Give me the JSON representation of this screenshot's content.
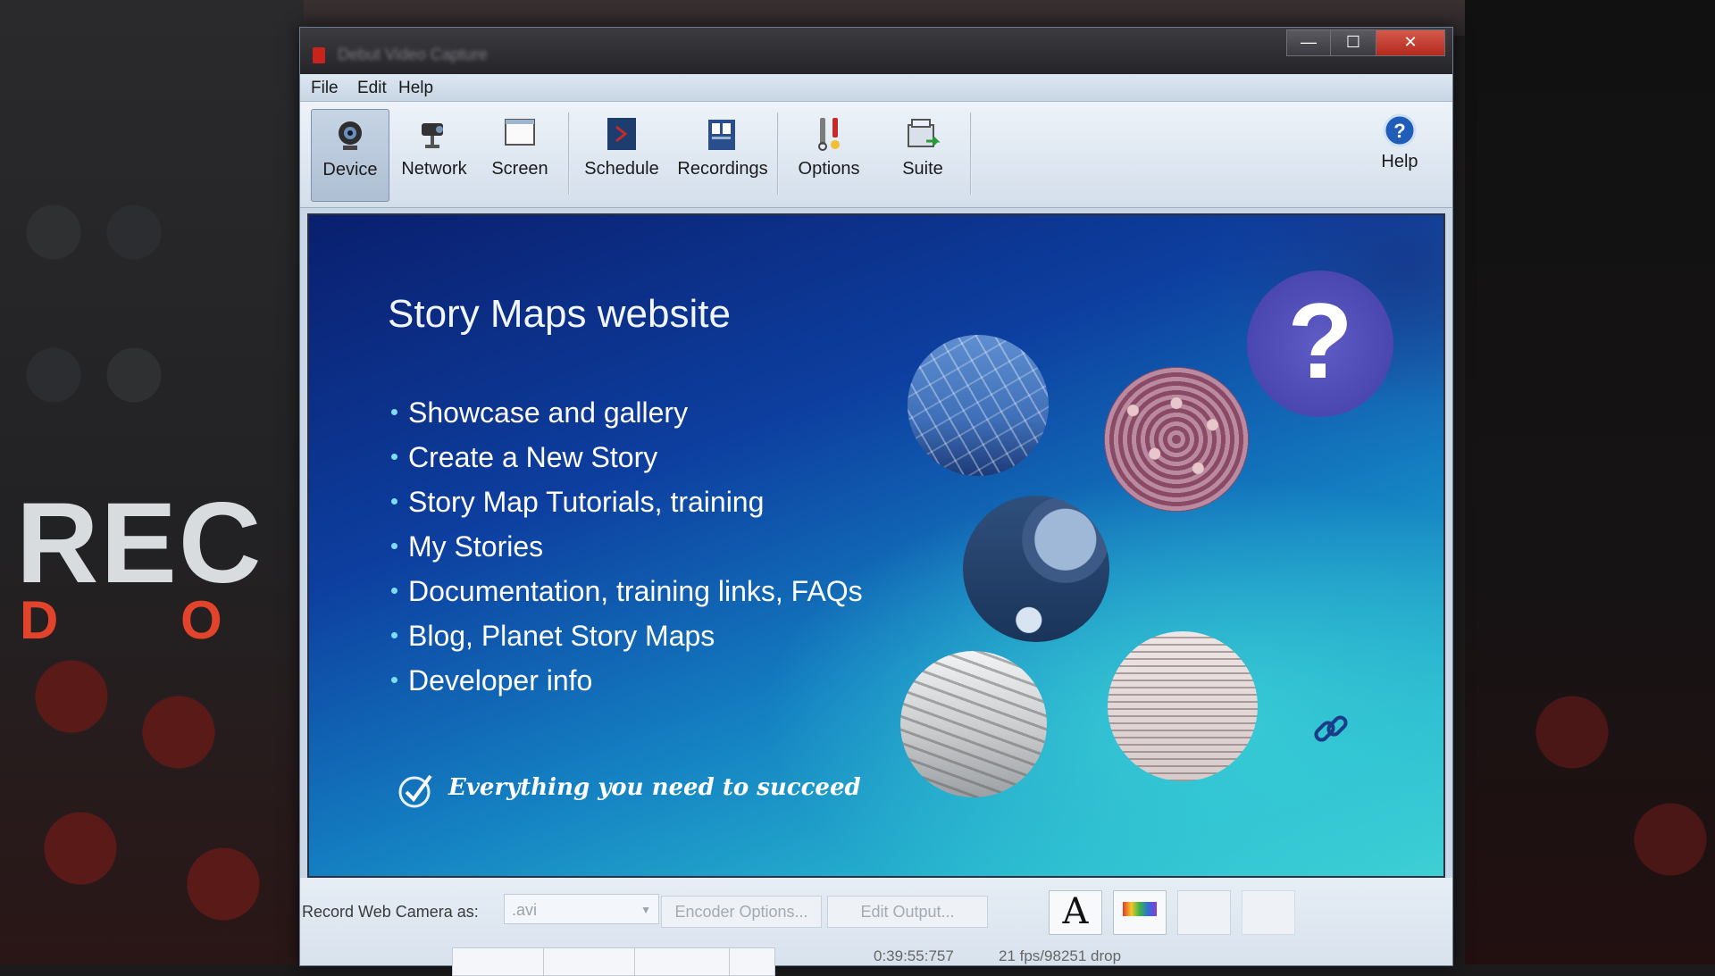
{
  "background": {
    "logo_text": "REC",
    "logo_sub": "D O"
  },
  "window": {
    "title": "Debut Video Capture",
    "controls": {
      "minimize": "—",
      "maximize": "☐",
      "close": "✕"
    }
  },
  "menu": [
    "File",
    "Edit",
    "Help"
  ],
  "toolbar": {
    "device": "Device",
    "network": "Network",
    "screen": "Screen",
    "schedule": "Schedule",
    "recordings": "Recordings",
    "options": "Options",
    "suite": "Suite",
    "help": "Help"
  },
  "slide": {
    "title": "Story Maps website",
    "bullets": [
      "Showcase and gallery",
      "Create a New Story",
      "Story Map Tutorials, training",
      "My Stories",
      "Documentation, training links, FAQs",
      "Blog, Planet Story Maps",
      "Developer info"
    ],
    "tagline": "Everything you need to succeed",
    "question_mark": "?"
  },
  "controls": {
    "record_label": "Record Web Camera as:",
    "format_value": ".avi",
    "encoder_options": "Encoder Options...",
    "edit_output": "Edit Output...",
    "font_glyph": "A",
    "elapsed_time": "0:39:55:757",
    "fps_status": "21 fps/98251 drop"
  },
  "colors": {
    "accent": "#c8231c",
    "slide_blue": "#0d3fa0",
    "slide_teal": "#3fd0d4"
  }
}
